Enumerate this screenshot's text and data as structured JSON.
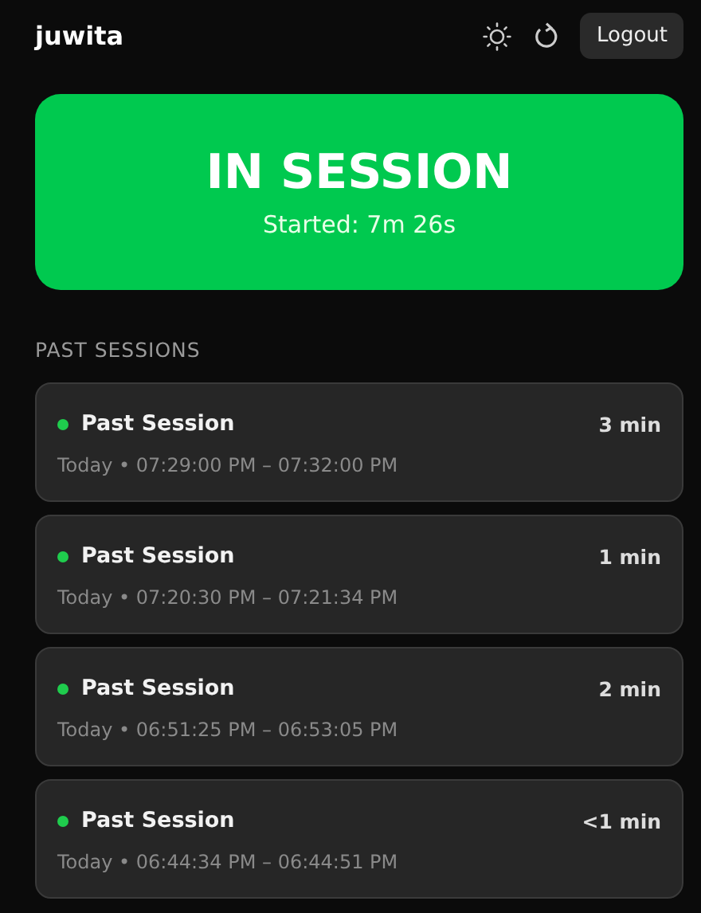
{
  "header": {
    "username": "juwita",
    "logout_label": "Logout"
  },
  "status": {
    "title": "IN SESSION",
    "subtitle": "Started: 7m 26s"
  },
  "past_sessions": {
    "heading": "PAST SESSIONS",
    "items": [
      {
        "title": "Past Session",
        "duration": "3 min",
        "time": "Today • 07:29:00 PM – 07:32:00 PM"
      },
      {
        "title": "Past Session",
        "duration": "1 min",
        "time": "Today • 07:20:30 PM – 07:21:34 PM"
      },
      {
        "title": "Past Session",
        "duration": "2 min",
        "time": "Today • 06:51:25 PM – 06:53:05 PM"
      },
      {
        "title": "Past Session",
        "duration": "<1 min",
        "time": "Today • 06:44:34 PM – 06:44:51 PM"
      }
    ]
  }
}
